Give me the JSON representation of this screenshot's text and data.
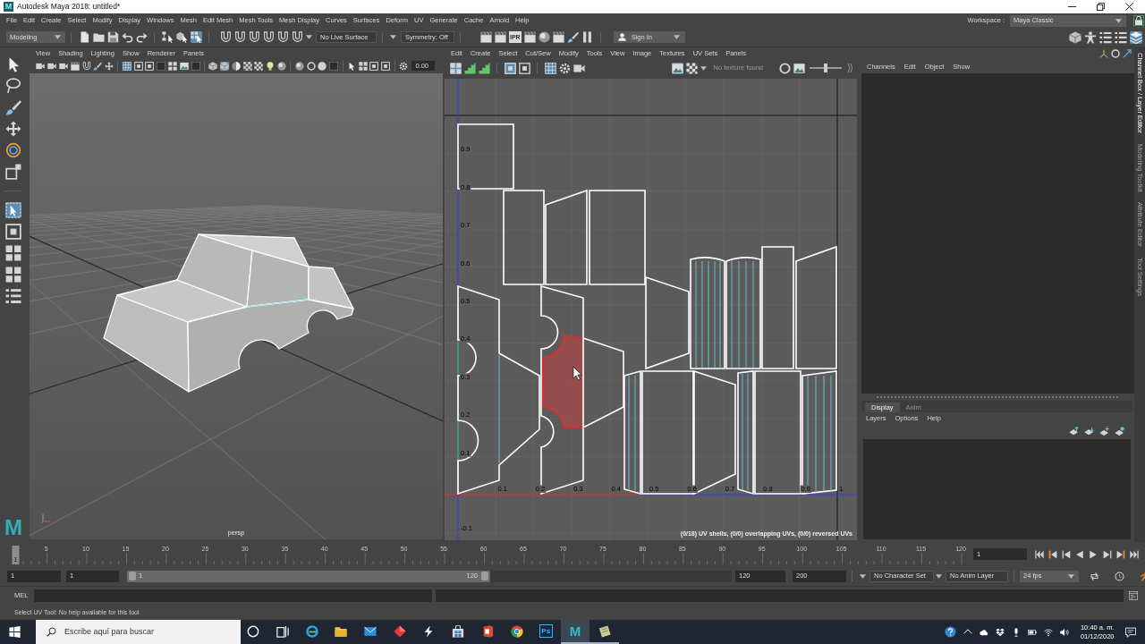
{
  "window": {
    "app_icon": "M",
    "title": "Autodesk Maya 2018: untitled*"
  },
  "menu_bar": [
    "File",
    "Edit",
    "Create",
    "Select",
    "Modify",
    "Display",
    "Windows",
    "Mesh",
    "Edit Mesh",
    "Mesh Tools",
    "Mesh Display",
    "Curves",
    "Surfaces",
    "Deform",
    "UV",
    "Generate",
    "Cache",
    "Arnold",
    "Help"
  ],
  "workspace": {
    "label": "Workspace :",
    "value": "Maya Classic",
    "locked": true
  },
  "status_line": {
    "menu_set": "Modeling",
    "tools": [
      {
        "on": false
      },
      {
        "on": false
      },
      {
        "on": false
      },
      {
        "on": false
      },
      {
        "on": false
      },
      {
        "on": false
      },
      {
        "on": false
      },
      {
        "on": true
      },
      {
        "on": false
      },
      {
        "on": false
      },
      {
        "on": false
      },
      {
        "on": false
      },
      {
        "on": false
      },
      {
        "on": false
      },
      {
        "on": false
      },
      {
        "on": false
      },
      {
        "label": "IPR",
        "on": false
      },
      {
        "on": false
      },
      {
        "on": false
      },
      {
        "on": false
      },
      {
        "on": false
      },
      {
        "on": false
      }
    ],
    "live_surface": "No Live Surface",
    "symmetry": "Symmetry: Off",
    "sign_in": "Sign In",
    "panel_tools": [
      {
        "on": false
      },
      {
        "on": false
      },
      {
        "on": false
      },
      {
        "on": false
      },
      {
        "on": true
      }
    ]
  },
  "toolbox": {
    "tools": [
      {
        "on": false
      },
      {
        "on": false
      },
      {
        "on": false
      },
      {
        "on": false
      },
      {
        "on": false
      },
      {
        "on": false
      },
      {
        "on": true
      },
      {
        "on": false
      },
      {
        "on": false
      },
      {
        "on": false
      },
      {
        "on": false
      }
    ],
    "logo": "M"
  },
  "viewport": {
    "menus": [
      "View",
      "Shading",
      "Lighting",
      "Show",
      "Renderer",
      "Panels"
    ],
    "tools": [
      {
        "on": false
      },
      {
        "on": false
      },
      {
        "on": false
      },
      {
        "on": false
      },
      {
        "on": false
      },
      {
        "on": false
      },
      {
        "on": false
      },
      {
        "on": true
      },
      {
        "on": false
      },
      {
        "on": false
      },
      {
        "on": false
      },
      {
        "on": false
      },
      {
        "on": false
      },
      {
        "on": false
      },
      {
        "on": false
      },
      {
        "on": true
      },
      {
        "on": false
      },
      {
        "on": true
      },
      {
        "on": false
      },
      {
        "on": false
      },
      {
        "on": false
      },
      {
        "on": false
      },
      {
        "on": false
      },
      {
        "on": false
      },
      {
        "on": false
      },
      {
        "on": false
      },
      {
        "on": false
      },
      {
        "on": false
      },
      {
        "on": false
      },
      {
        "on": false
      }
    ],
    "exposure": "0.00",
    "camera": "persp"
  },
  "uv_editor": {
    "menus": [
      "Edit",
      "Create",
      "Select",
      "Cut/Sew",
      "Modify",
      "Tools",
      "View",
      "Image",
      "Textures",
      "UV Sets",
      "Panels"
    ],
    "tools": [
      {
        "on": true
      },
      {
        "on": false
      },
      {
        "on": false
      },
      {
        "on": true
      },
      {
        "on": false
      },
      {
        "on": true
      },
      {
        "on": false
      },
      {
        "on": false
      },
      {
        "on": true
      },
      {
        "on": false
      },
      {
        "on": false
      },
      {
        "on": false
      }
    ],
    "texture": "No texture found",
    "slider": {
      "level": 0.5
    },
    "u_labels": [
      "0.1",
      "0.2",
      "0.3",
      "0.4",
      "0.5",
      "0.6",
      "0.7",
      "0.8",
      "0.9",
      "1"
    ],
    "v_labels": [
      "0.9",
      "0.8",
      "0.7",
      "0.6",
      "0.5",
      "0.4",
      "0.3",
      "0.2",
      "0.1",
      "-0.1"
    ],
    "shells": [
      {
        "selected": false
      },
      {
        "selected": false
      },
      {
        "selected": false
      },
      {
        "selected": false
      },
      {
        "selected": false
      },
      {
        "selected": false
      },
      {
        "selected": true
      },
      {
        "selected": false
      },
      {
        "selected": false
      },
      {
        "selected": false
      },
      {
        "selected": false
      },
      {
        "selected": false
      },
      {
        "selected": false
      },
      {
        "selected": false
      },
      {
        "selected": false
      },
      {
        "selected": false
      },
      {
        "selected": false
      },
      {
        "selected": false
      },
      {
        "selected": false
      }
    ],
    "summary": "(0/18) UV shells, (0/0) overlapping UVs, (0/0) reversed UVs"
  },
  "channel_box": {
    "menus": [
      "Channels",
      "Edit",
      "Object",
      "Show"
    ]
  },
  "layer_editor": {
    "tabs": [
      {
        "label": "Display",
        "selected": true
      },
      {
        "label": "Anim",
        "selected": false
      }
    ],
    "menus": [
      "Layers",
      "Options",
      "Help"
    ]
  },
  "side_tabs": [
    {
      "label": "Channel Box / Layer Editor",
      "selected": true
    },
    {
      "label": "Modeling Toolkit",
      "selected": false
    },
    {
      "label": "Attribute Editor",
      "selected": false
    },
    {
      "label": "Tool Settings",
      "selected": false
    }
  ],
  "time_slider": {
    "current_frame": "1",
    "ticks": [
      "5",
      "10",
      "15",
      "20",
      "25",
      "30",
      "35",
      "40",
      "45",
      "50",
      "55",
      "60",
      "65",
      "70",
      "75",
      "80",
      "85",
      "90",
      "95",
      "100",
      "105",
      "110",
      "115",
      "120"
    ],
    "frame_field": "1"
  },
  "range_slider": {
    "start": "1",
    "range_start": "1",
    "bar_start": "1",
    "bar_end": "120",
    "range_end": "120",
    "end": "200",
    "character_set": "No Character Set",
    "anim_layer": "No Anim Layer",
    "fps": "24 fps"
  },
  "command_line": {
    "language": "MEL"
  },
  "help_line": "Select UV Tool: No help available for this tool",
  "taskbar": {
    "search_placeholder": "Escribe aquí para buscar",
    "apps": [
      {
        "active": false,
        "running": false
      },
      {
        "active": false,
        "running": false
      },
      {
        "active": false,
        "running": false
      },
      {
        "active": false,
        "running": false
      },
      {
        "active": false,
        "running": false
      },
      {
        "active": false,
        "running": false
      },
      {
        "active": false,
        "running": false
      },
      {
        "active": false,
        "running": false
      },
      {
        "active": false,
        "running": false
      },
      {
        "active": false,
        "running": false
      },
      {
        "label": "Ps",
        "active": false,
        "running": false
      },
      {
        "label": "M",
        "active": true,
        "running": true
      },
      {
        "active": false,
        "running": true
      }
    ],
    "time": "10:40 a. m.",
    "date": "01/12/2020"
  }
}
